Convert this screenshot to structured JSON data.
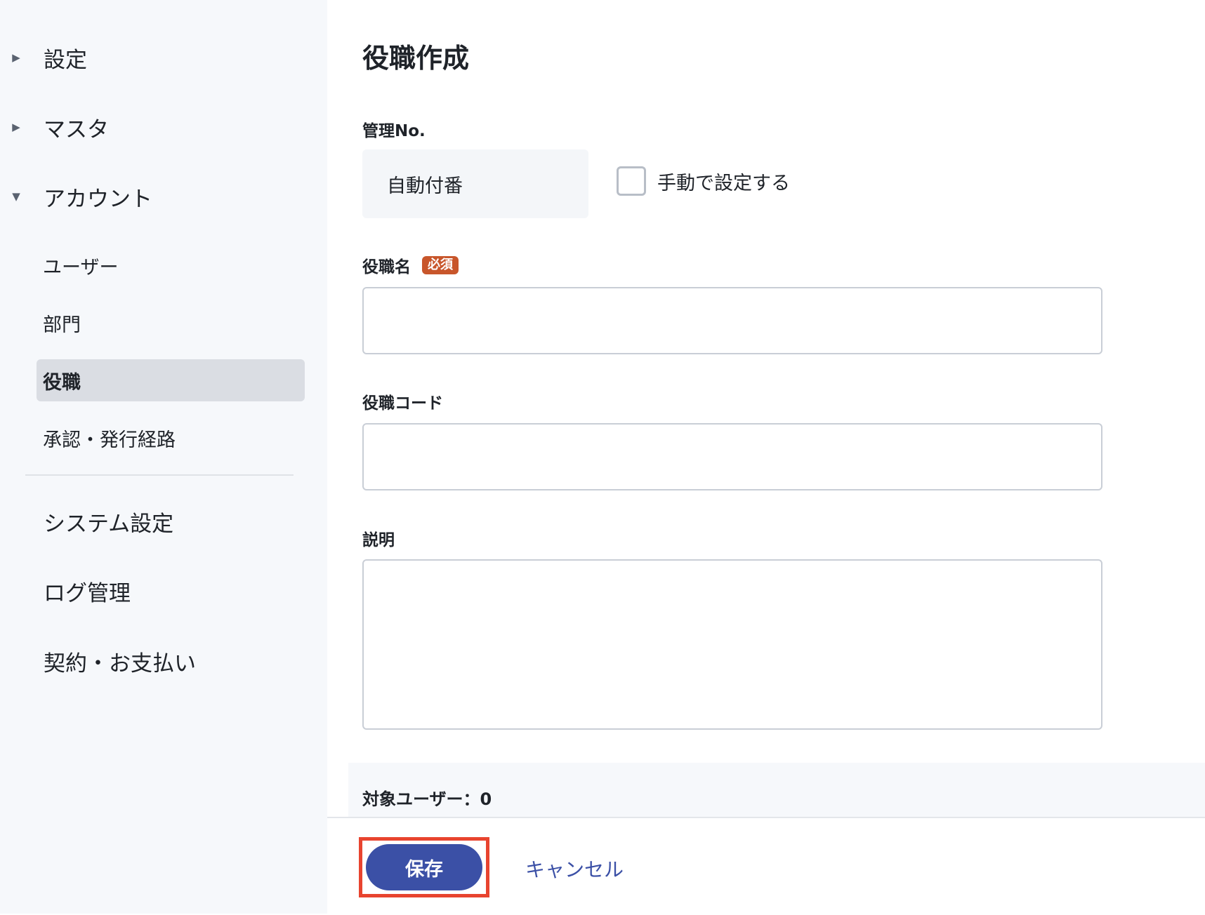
{
  "sidebar": {
    "groups": [
      {
        "label": "設定",
        "expanded": false
      },
      {
        "label": "マスタ",
        "expanded": false
      },
      {
        "label": "アカウント",
        "expanded": true
      }
    ],
    "account_items": [
      {
        "label": "ユーザー"
      },
      {
        "label": "部門"
      },
      {
        "label": "役職",
        "active": true
      },
      {
        "label": "承認・発行経路"
      }
    ],
    "bottom_items": [
      {
        "label": "システム設定"
      },
      {
        "label": "ログ管理"
      },
      {
        "label": "契約・お支払い"
      }
    ]
  },
  "main": {
    "title": "役職作成",
    "management_no": {
      "label": "管理No.",
      "value": "自動付番",
      "manual_checkbox_label": "手動で設定する",
      "manual_checked": false
    },
    "position_name": {
      "label": "役職名",
      "required_badge": "必須",
      "value": ""
    },
    "position_code": {
      "label": "役職コード",
      "value": ""
    },
    "description": {
      "label": "説明",
      "value": ""
    },
    "target_users": "対象ユーザー：0"
  },
  "footer": {
    "save_label": "保存",
    "cancel_label": "キャンセル"
  },
  "colors": {
    "accent": "#3b50a6",
    "badge": "#c8562b",
    "highlight": "#e8442f",
    "sidebar_bg": "#f6f8fb"
  }
}
